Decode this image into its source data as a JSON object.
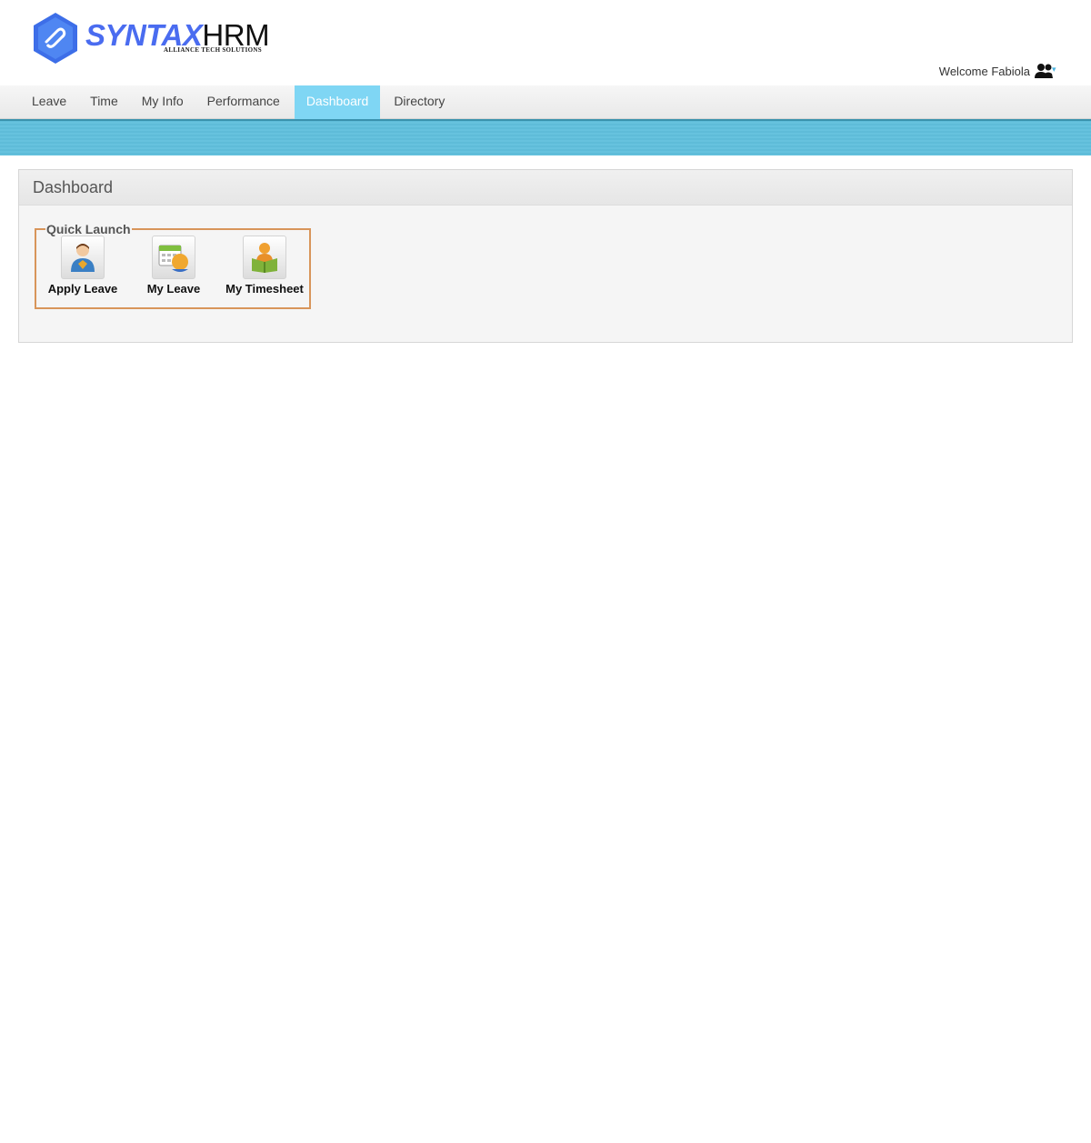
{
  "brand": {
    "name_part1": "SYNTAX",
    "name_part2": "HRM",
    "tagline": "ALLIANCE TECH SOLUTIONS",
    "accent": "#4a6cf0"
  },
  "header": {
    "welcome": "Welcome Fabiola",
    "user_icon": "users-icon"
  },
  "nav": {
    "items": [
      {
        "label": "Leave"
      },
      {
        "label": "Time"
      },
      {
        "label": "My Info"
      },
      {
        "label": "Performance"
      },
      {
        "label": "Dashboard",
        "active": true
      },
      {
        "label": "Directory"
      }
    ],
    "active_color": "#7fd6f4"
  },
  "panel": {
    "title": "Dashboard",
    "quick_launch": {
      "legend": "Quick Launch",
      "items": [
        {
          "label": "Apply Leave",
          "icon": "apply-leave-icon"
        },
        {
          "label": "My Leave",
          "icon": "calendar-leave-icon"
        },
        {
          "label": "My Timesheet",
          "icon": "timesheet-icon"
        }
      ]
    }
  }
}
